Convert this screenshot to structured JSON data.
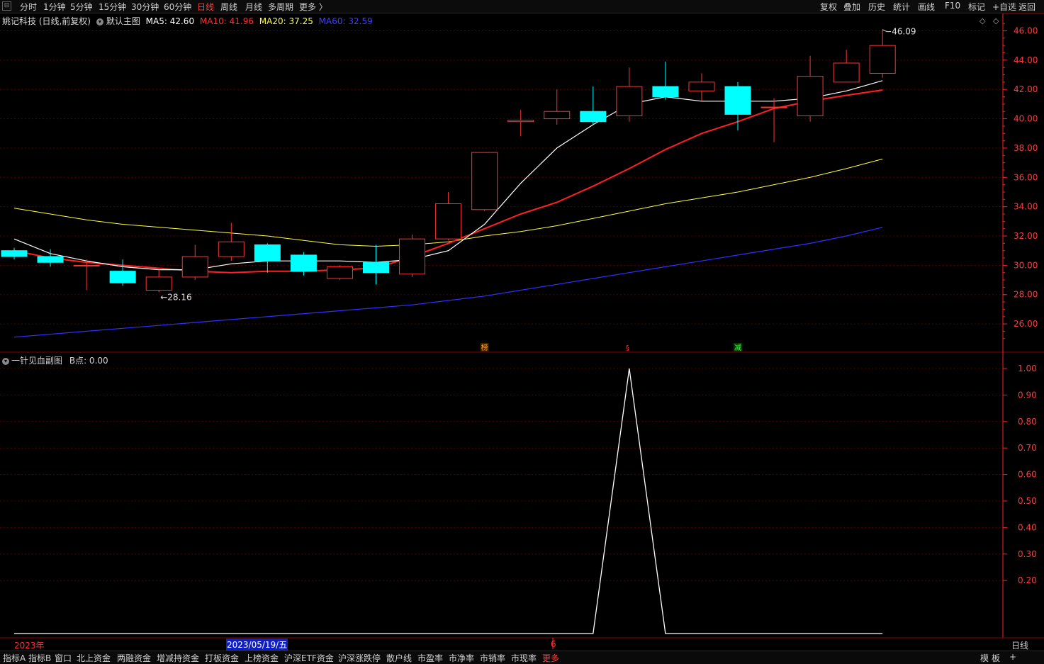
{
  "toolbar": {
    "periods": [
      "分时",
      "1分钟",
      "5分钟",
      "15分钟",
      "30分钟",
      "60分钟",
      "日线",
      "周线",
      "月线",
      "多周期",
      "更多 〉"
    ],
    "active_period": "日线",
    "right_buttons": [
      "复权",
      "叠加",
      "历史",
      "统计",
      "画线",
      "F10",
      "标记",
      "+自选",
      "返回"
    ]
  },
  "main_legend": {
    "stock": "姚记科技 (日线,前复权)",
    "template": "默认主图",
    "ma5": "MA5: 42.60",
    "ma10": "MA10: 41.96",
    "ma20": "MA20: 37.25",
    "ma60": "MA60: 32.59"
  },
  "sub_legend": {
    "name": "一针见血副图",
    "value": "B点: 0.00"
  },
  "markers": {
    "bang": "榜",
    "s": "§",
    "jian": "减"
  },
  "price_axis": [
    "46.00",
    "44.00",
    "42.00",
    "40.00",
    "38.00",
    "36.00",
    "34.00",
    "32.00",
    "30.00",
    "28.00",
    "26.00"
  ],
  "sub_axis": [
    "1.00",
    "0.90",
    "0.80",
    "0.70",
    "0.60",
    "0.50",
    "0.40",
    "0.30",
    "0.20"
  ],
  "annotations": {
    "high": "46.09",
    "low": "28.16"
  },
  "date_axis": {
    "year": "2023年",
    "cursor_date": "2023/05/19/五",
    "month": "6",
    "period_label": "日线"
  },
  "bottom_tabs": [
    "指标A",
    "指标B",
    "窗口",
    "北上资金",
    "两融资金",
    "增减持资金",
    "打板资金",
    "上榜资金",
    "沪深ETF资金",
    "沪深涨跌停",
    "散户线",
    "市盈率",
    "市净率",
    "市销率",
    "市现率",
    "更多"
  ],
  "bottom_right": [
    "模",
    "板",
    "+"
  ],
  "colors": {
    "up": "#ff3333",
    "down": "#00ffff",
    "ma5": "#ffffff",
    "ma10": "#ff2020",
    "ma20": "#ffff40",
    "ma60": "#3030ff",
    "grid": "#5a0000",
    "axis": "#ff2020"
  },
  "chart_data": {
    "type": "candlestick",
    "price_range": [
      24.2,
      46.9
    ],
    "candles": [
      {
        "o": 31.0,
        "c": 30.6,
        "h": 31.2,
        "l": 30.4
      },
      {
        "o": 30.6,
        "c": 30.2,
        "h": 31.1,
        "l": 29.9
      },
      {
        "o": 30.0,
        "c": 30.0,
        "h": 30.4,
        "l": 28.3
      },
      {
        "o": 29.6,
        "c": 28.8,
        "h": 30.4,
        "l": 28.6
      },
      {
        "o": 28.3,
        "c": 29.2,
        "h": 29.7,
        "l": 28.16
      },
      {
        "o": 29.2,
        "c": 30.6,
        "h": 31.4,
        "l": 29.0
      },
      {
        "o": 30.6,
        "c": 31.6,
        "h": 32.9,
        "l": 30.3
      },
      {
        "o": 31.4,
        "c": 30.3,
        "h": 31.5,
        "l": 29.5
      },
      {
        "o": 30.7,
        "c": 29.6,
        "h": 30.9,
        "l": 29.3
      },
      {
        "o": 29.1,
        "c": 29.9,
        "h": 30.0,
        "l": 29.0
      },
      {
        "o": 30.2,
        "c": 29.5,
        "h": 31.4,
        "l": 28.7
      },
      {
        "o": 29.4,
        "c": 31.8,
        "h": 32.1,
        "l": 29.2
      },
      {
        "o": 31.8,
        "c": 34.2,
        "h": 35.0,
        "l": 31.7
      },
      {
        "o": 33.8,
        "c": 37.7,
        "h": 37.7,
        "l": 33.7
      },
      {
        "o": 39.8,
        "c": 39.9,
        "h": 40.6,
        "l": 38.8
      },
      {
        "o": 40.0,
        "c": 40.5,
        "h": 42.0,
        "l": 39.6
      },
      {
        "o": 40.5,
        "c": 39.8,
        "h": 42.2,
        "l": 39.6
      },
      {
        "o": 40.2,
        "c": 42.2,
        "h": 43.5,
        "l": 39.8
      },
      {
        "o": 42.2,
        "c": 41.5,
        "h": 43.9,
        "l": 41.3
      },
      {
        "o": 41.9,
        "c": 42.5,
        "h": 43.1,
        "l": 41.2
      },
      {
        "o": 42.2,
        "c": 40.3,
        "h": 42.5,
        "l": 39.2
      },
      {
        "o": 40.8,
        "c": 40.8,
        "h": 41.4,
        "l": 38.4
      },
      {
        "o": 40.2,
        "c": 42.9,
        "h": 44.3,
        "l": 39.8
      },
      {
        "o": 42.5,
        "c": 43.8,
        "h": 44.7,
        "l": 42.5
      },
      {
        "o": 43.1,
        "c": 45.0,
        "h": 46.09,
        "l": 42.8
      }
    ],
    "ma5": [
      31.8,
      30.8,
      30.3,
      29.9,
      29.7,
      29.7,
      30.1,
      30.3,
      30.3,
      30.3,
      30.2,
      30.4,
      31.0,
      32.8,
      35.6,
      38.0,
      39.6,
      41.0,
      41.5,
      41.2,
      41.2,
      41.2,
      41.4,
      41.9,
      42.6
    ],
    "ma10": [
      31.0,
      30.5,
      30.2,
      30.0,
      29.8,
      29.6,
      29.5,
      29.6,
      29.6,
      29.7,
      29.8,
      30.6,
      31.5,
      32.5,
      33.5,
      34.3,
      35.4,
      36.6,
      37.9,
      39.0,
      39.8,
      40.7,
      41.2,
      41.6,
      41.96
    ],
    "ma20": [
      33.9,
      33.5,
      33.1,
      32.8,
      32.6,
      32.4,
      32.2,
      32.0,
      31.7,
      31.4,
      31.3,
      31.4,
      31.6,
      32.0,
      32.3,
      32.7,
      33.2,
      33.7,
      34.2,
      34.6,
      35.0,
      35.5,
      36.0,
      36.6,
      37.25
    ],
    "ma60": [
      25.1,
      25.3,
      25.5,
      25.7,
      25.9,
      26.1,
      26.3,
      26.5,
      26.7,
      26.9,
      27.1,
      27.3,
      27.6,
      27.9,
      28.3,
      28.7,
      29.1,
      29.5,
      29.9,
      30.3,
      30.7,
      31.1,
      31.5,
      32.0,
      32.59
    ],
    "b_signal": [
      0,
      0,
      0,
      0,
      0,
      0,
      0,
      0,
      0,
      0,
      0,
      0,
      0,
      0,
      0,
      0,
      0,
      1,
      0,
      0,
      0,
      0,
      0,
      0,
      0
    ],
    "sub_range": [
      0,
      1.0
    ]
  }
}
